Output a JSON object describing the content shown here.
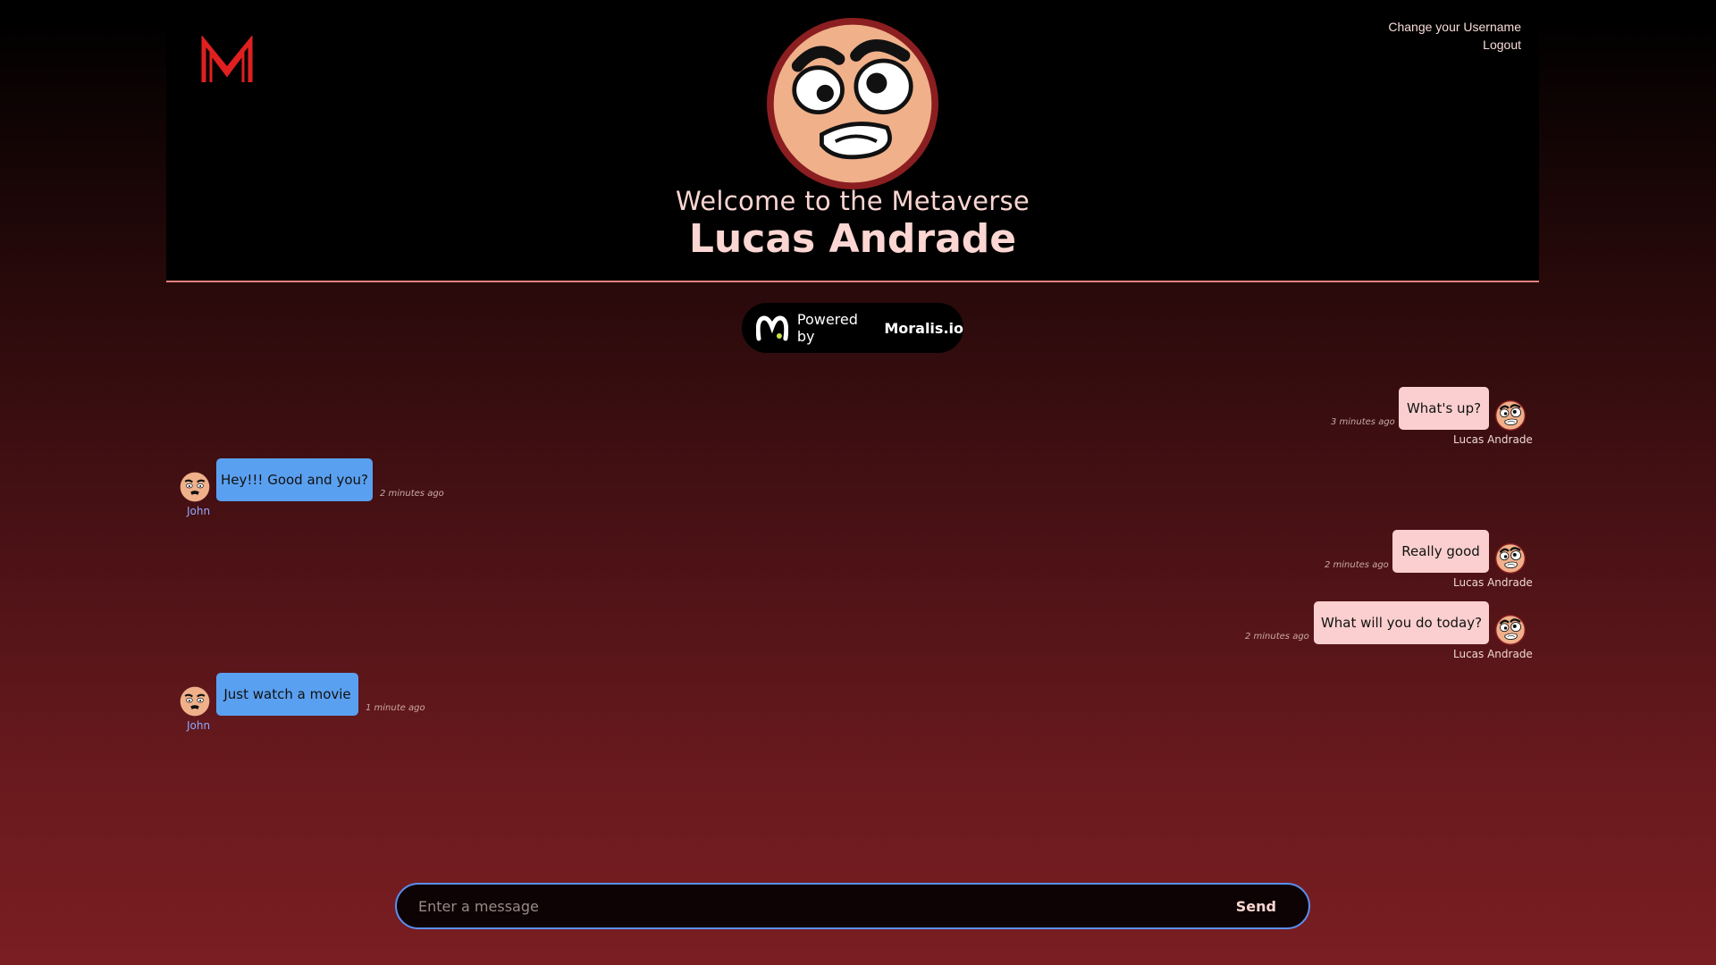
{
  "header": {
    "logo_icon": "moralis-m-logo-icon",
    "links": {
      "change_username": "Change your Username",
      "logout": "Logout"
    },
    "welcome": "Welcome to the Metaverse",
    "username": "Lucas Andrade",
    "avatar_icon": "cartoon-face-avatar-icon"
  },
  "powered": {
    "prefix": "Powered by",
    "brand": "Moralis.io",
    "icon": "moralis-logo-icon"
  },
  "messages": [
    {
      "text": "What's up?",
      "time": "3 minutes ago",
      "author": "Lucas Andrade",
      "own": true
    },
    {
      "text": "Hey!!! Good and you?",
      "time": "2 minutes ago",
      "author": "John",
      "own": false
    },
    {
      "text": "Really good",
      "time": "2 minutes ago",
      "author": "Lucas Andrade",
      "own": true
    },
    {
      "text": "What will you do today?",
      "time": "2 minutes ago",
      "author": "Lucas Andrade",
      "own": true
    },
    {
      "text": "Just watch a movie",
      "time": "1 minute ago",
      "author": "John",
      "own": false
    }
  ],
  "composer": {
    "placeholder": "Enter a message",
    "value": "",
    "send_label": "Send"
  },
  "colors": {
    "own_bubble": "#fbcfcf",
    "other_bubble": "#5aa0f0",
    "accent": "#fbd6d2",
    "header_border": "#e8807c"
  }
}
